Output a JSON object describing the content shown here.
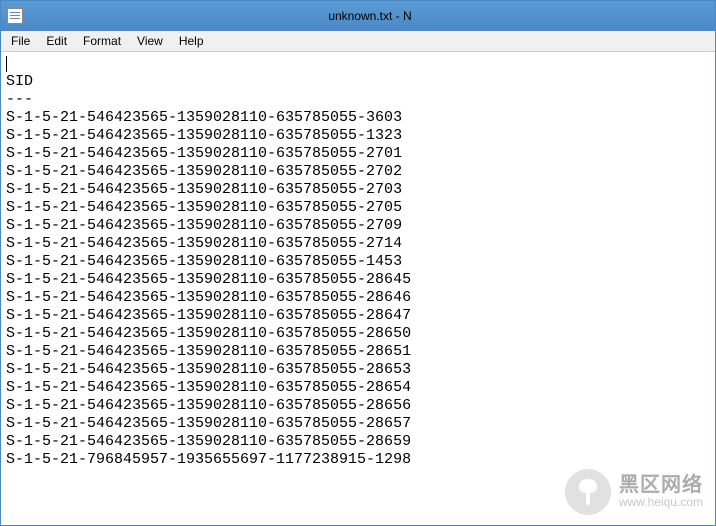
{
  "window": {
    "title": "unknown.txt - N"
  },
  "menu": {
    "file": "File",
    "edit": "Edit",
    "format": "Format",
    "view": "View",
    "help": "Help"
  },
  "document": {
    "header": "SID",
    "separator": "---",
    "lines": [
      "S-1-5-21-546423565-1359028110-635785055-3603",
      "S-1-5-21-546423565-1359028110-635785055-1323",
      "S-1-5-21-546423565-1359028110-635785055-2701",
      "S-1-5-21-546423565-1359028110-635785055-2702",
      "S-1-5-21-546423565-1359028110-635785055-2703",
      "S-1-5-21-546423565-1359028110-635785055-2705",
      "S-1-5-21-546423565-1359028110-635785055-2709",
      "S-1-5-21-546423565-1359028110-635785055-2714",
      "S-1-5-21-546423565-1359028110-635785055-1453",
      "S-1-5-21-546423565-1359028110-635785055-28645",
      "S-1-5-21-546423565-1359028110-635785055-28646",
      "S-1-5-21-546423565-1359028110-635785055-28647",
      "S-1-5-21-546423565-1359028110-635785055-28650",
      "S-1-5-21-546423565-1359028110-635785055-28651",
      "S-1-5-21-546423565-1359028110-635785055-28653",
      "S-1-5-21-546423565-1359028110-635785055-28654",
      "S-1-5-21-546423565-1359028110-635785055-28656",
      "S-1-5-21-546423565-1359028110-635785055-28657",
      "S-1-5-21-546423565-1359028110-635785055-28659",
      "S-1-5-21-796845957-1935655697-1177238915-1298"
    ]
  },
  "watermark": {
    "title": "黑区网络",
    "url": "www.heiqu.com"
  }
}
